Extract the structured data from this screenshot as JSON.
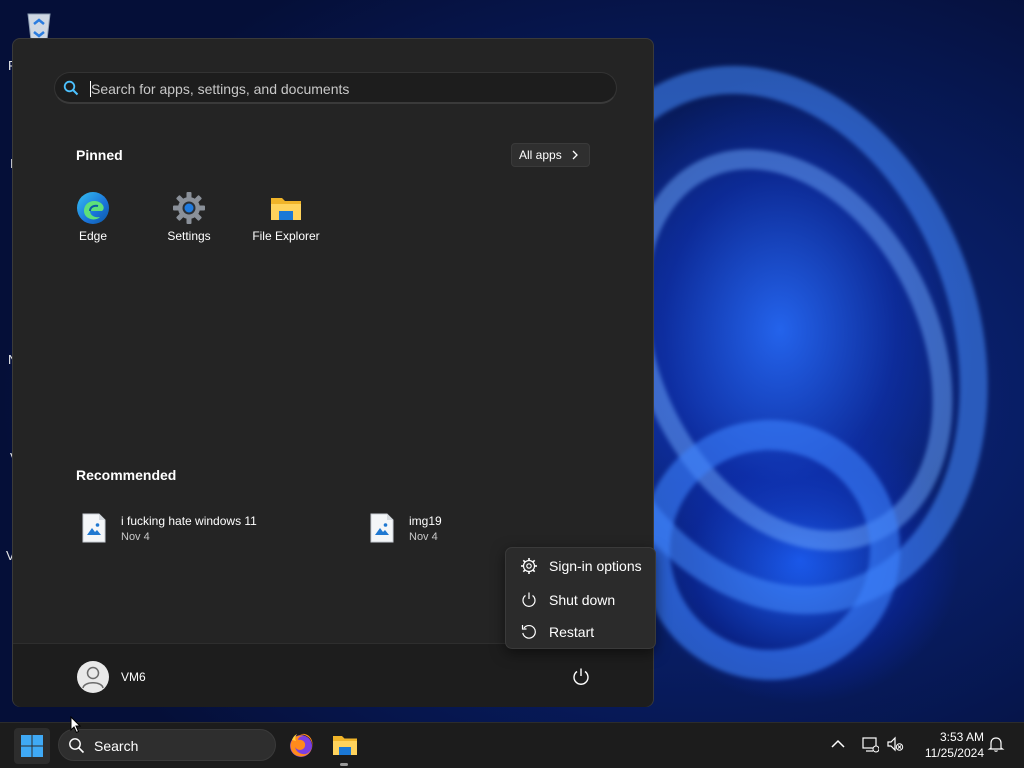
{
  "start_menu": {
    "search_placeholder": "Search for apps, settings, and documents",
    "pinned_title": "Pinned",
    "all_apps_label": "All apps",
    "pinned_apps": [
      {
        "label": "Edge",
        "icon": "edge-icon"
      },
      {
        "label": "Settings",
        "icon": "gear-icon"
      },
      {
        "label": "File Explorer",
        "icon": "folder-icon"
      }
    ],
    "recommended_title": "Recommended",
    "recommended": [
      {
        "name": "i fucking hate windows 11",
        "date": "Nov 4",
        "icon": "image-file-icon"
      },
      {
        "name": "img19",
        "date": "Nov 4",
        "icon": "image-file-icon"
      }
    ],
    "user_name": "VM6",
    "power_menu": [
      {
        "label": "Sign-in options",
        "icon": "gear-icon"
      },
      {
        "label": "Shut down",
        "icon": "power-icon"
      },
      {
        "label": "Restart",
        "icon": "restart-icon"
      }
    ]
  },
  "taskbar": {
    "search_label": "Search",
    "apps": [
      {
        "icon": "firefox-icon"
      },
      {
        "icon": "file-explorer-icon"
      }
    ],
    "tray_icons": [
      "chevron-up-icon",
      "network-icon",
      "volume-muted-icon",
      "notification-bell-icon"
    ],
    "time": "3:53 AM",
    "date": "11/25/2024"
  },
  "desktop": {
    "icons": [
      "recycle-bin-icon"
    ],
    "edge_letters": [
      "F",
      "I",
      "N",
      "V",
      "V"
    ]
  },
  "colors": {
    "menu_bg": "#242424",
    "taskbar_bg": "#1c1c1c",
    "accent": "#0078d4"
  }
}
